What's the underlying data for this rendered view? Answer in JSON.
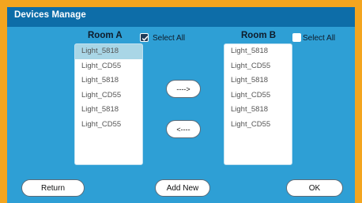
{
  "window": {
    "title": "Devices Manage"
  },
  "room_a": {
    "title": "Room A",
    "select_all_label": "Select All",
    "select_all_checked": true,
    "items": [
      {
        "label": "Light_5818",
        "selected": true
      },
      {
        "label": "Light_CD55",
        "selected": false
      },
      {
        "label": "Light_5818",
        "selected": false
      },
      {
        "label": "Light_CD55",
        "selected": false
      },
      {
        "label": "Light_5818",
        "selected": false
      },
      {
        "label": "Light_CD55",
        "selected": false
      }
    ]
  },
  "room_b": {
    "title": "Room B",
    "select_all_label": "Select All",
    "select_all_checked": false,
    "items": [
      {
        "label": "Light_5818",
        "selected": false
      },
      {
        "label": "Light_CD55",
        "selected": false
      },
      {
        "label": "Light_5818",
        "selected": false
      },
      {
        "label": "Light_CD55",
        "selected": false
      },
      {
        "label": "Light_5818",
        "selected": false
      },
      {
        "label": "Light_CD55",
        "selected": false
      }
    ]
  },
  "controls": {
    "move_right_label": "---->",
    "move_left_label": "<----"
  },
  "footer": {
    "return_label": "Return",
    "add_new_label": "Add New",
    "ok_label": "OK"
  },
  "colors": {
    "border": "#f3a51f",
    "titlebar": "#0d6da8",
    "panel": "#2e9fd5",
    "selected_item": "#a9d6e6"
  }
}
